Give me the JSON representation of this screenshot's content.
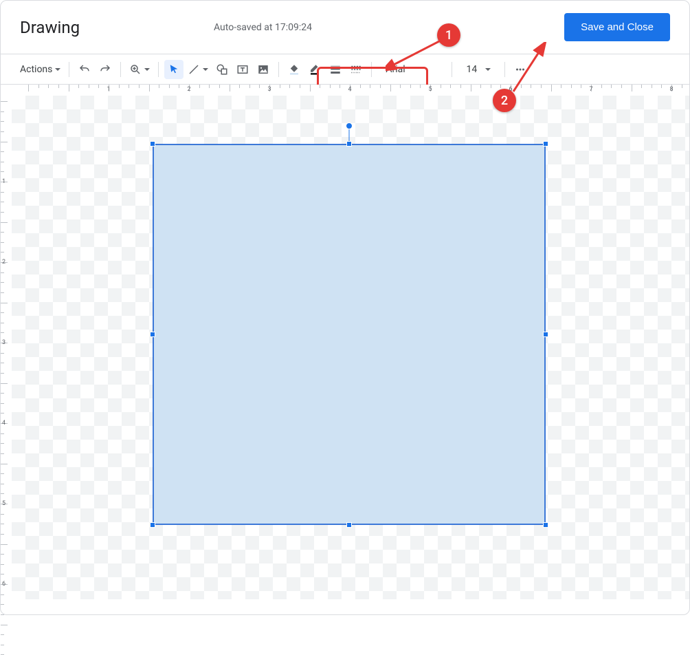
{
  "header": {
    "title": "Drawing",
    "autosaved": "Auto-saved at 17:09:24",
    "save_close": "Save and Close"
  },
  "toolbar": {
    "actions": "Actions",
    "font": "Arial",
    "font_size": "14"
  },
  "ruler_h": [
    1,
    2,
    3,
    4,
    5,
    6,
    7,
    8
  ],
  "ruler_v": [
    1,
    2,
    3,
    4,
    5,
    6
  ],
  "callouts": {
    "one": "1",
    "two": "2"
  }
}
